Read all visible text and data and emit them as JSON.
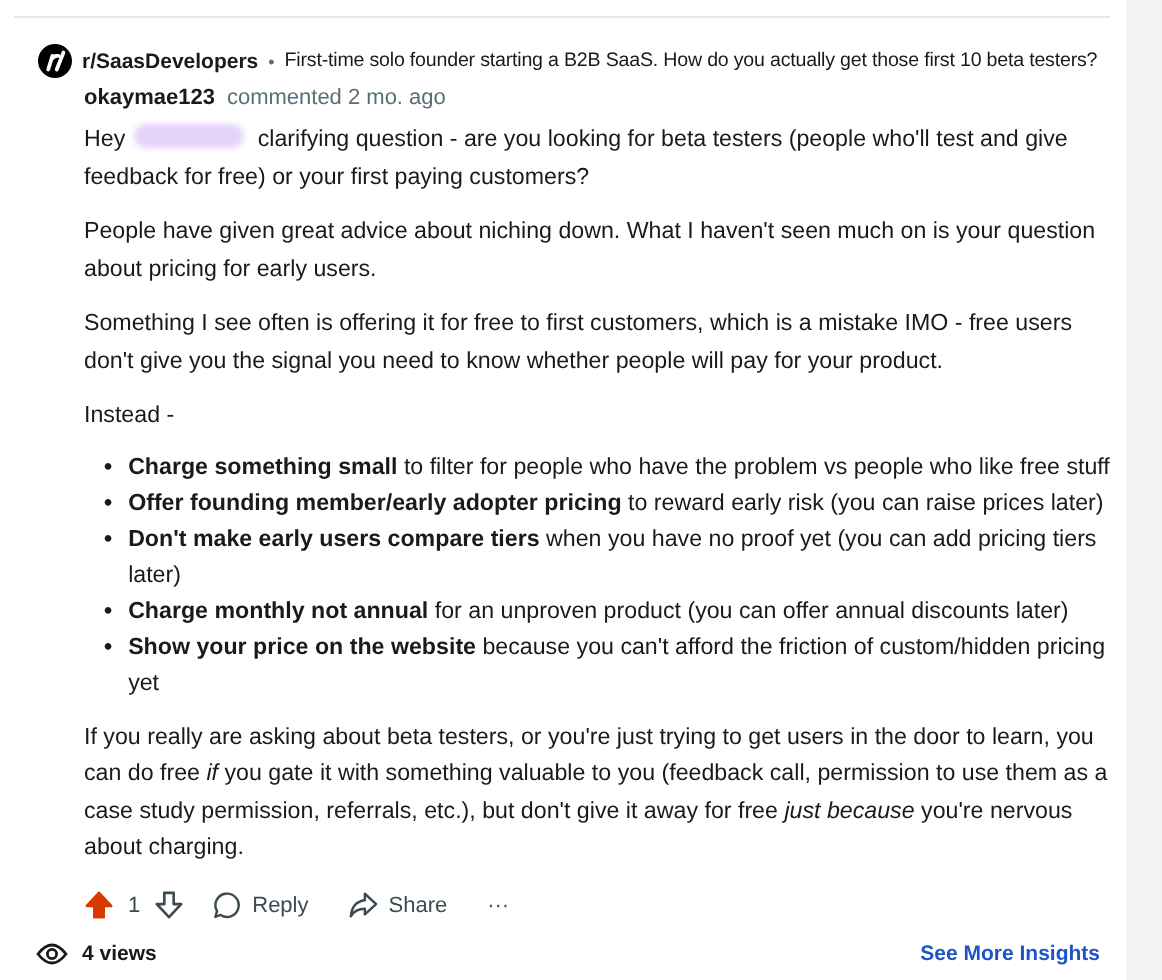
{
  "post": {
    "subreddit": "r/SaasDevelopers",
    "separator": "•",
    "title": "First-time solo founder starting a B2B SaaS. How do you actually get those first 10 beta testers?"
  },
  "comment": {
    "author": "okaymae123",
    "meta": "commented 2 mo. ago",
    "body": [
      {
        "kind": "segments",
        "segments": [
          {
            "kind": "text",
            "text": "Hey"
          },
          {
            "kind": "redacted"
          },
          {
            "kind": "text",
            "text": "clarifying question - are you looking for beta testers (people who'll test and give feedback for free) or your first paying customers?"
          }
        ]
      },
      {
        "kind": "paragraph",
        "text": "People have given great advice about niching down. What I haven't seen much on is your question about pricing for early users."
      },
      {
        "kind": "paragraph",
        "text": "Something I see often is offering it for free to first customers, which is a mistake IMO - free users don't give you the signal you need to know whether people will pay for your product."
      },
      {
        "kind": "paragraph",
        "text": "Instead -"
      },
      {
        "kind": "list",
        "marker": "•",
        "items": [
          "**Charge something small** to filter for people who have the problem vs people who like free stuff",
          "**Offer founding member/early adopter pricing** to reward early risk (you can raise prices later)",
          "**Don't make early users compare tiers** when you have no proof yet (you can add pricing tiers later)",
          "**Charge monthly not annual** for an unproven product (you can offer annual discounts later)",
          "**Show your price on the website** because you can't afford the friction of custom/hidden pricing yet"
        ]
      },
      {
        "kind": "paragraph",
        "text": "If you really are asking about beta testers, or you're just trying to get users in the door to learn, you can do free *if* you gate it with something valuable to you (feedback call, permission to use them as a case study permission, referrals, etc.), but don't give it away for free *just because* you're nervous about charging."
      }
    ],
    "upvoted": true,
    "score": "1",
    "reply": "Reply",
    "share": "Share",
    "more": "···"
  },
  "footer": {
    "views": "4 views",
    "insights": "See More Insights"
  }
}
